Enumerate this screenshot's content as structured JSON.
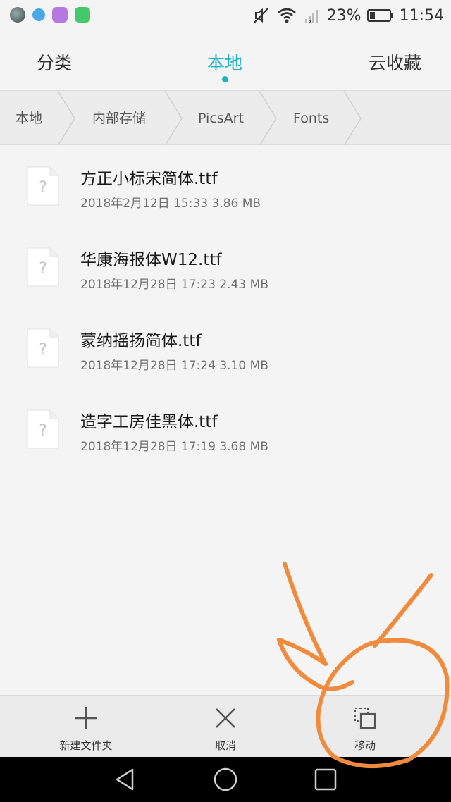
{
  "status_bar": {
    "battery": "23%",
    "time": "11:54",
    "icons": [
      "gallery-icon",
      "browser-icon",
      "photos-icon",
      "security-icon",
      "mute-icon",
      "wifi-icon",
      "signal-icon",
      "battery-icon"
    ]
  },
  "tabs": [
    {
      "label": "分类",
      "active": false
    },
    {
      "label": "本地",
      "active": true
    },
    {
      "label": "云收藏",
      "active": false
    }
  ],
  "accent_color": "#1bb3c3",
  "breadcrumb": [
    "本地",
    "内部存储",
    "PicsArt",
    "Fonts"
  ],
  "files": [
    {
      "name": "方正小标宋简体.ttf",
      "meta": "2018年2月12日 15:33 3.86 MB",
      "icon": "unknown-file-icon"
    },
    {
      "name": "华康海报体W12.ttf",
      "meta": "2018年12月28日 17:23 2.43 MB",
      "icon": "unknown-file-icon"
    },
    {
      "name": "蒙纳摇扬简体.ttf",
      "meta": "2018年12月28日 17:24 3.10 MB",
      "icon": "unknown-file-icon"
    },
    {
      "name": "造字工房佳黑体.ttf",
      "meta": "2018年12月28日 17:19 3.68 MB",
      "icon": "unknown-file-icon"
    }
  ],
  "actions": [
    {
      "label": "新建文件夹",
      "icon": "plus-icon"
    },
    {
      "label": "取消",
      "icon": "close-icon"
    },
    {
      "label": "移动",
      "icon": "move-icon"
    }
  ],
  "nav": [
    "back-icon",
    "home-icon",
    "recents-icon"
  ],
  "annotation_color": "#f08a3c"
}
